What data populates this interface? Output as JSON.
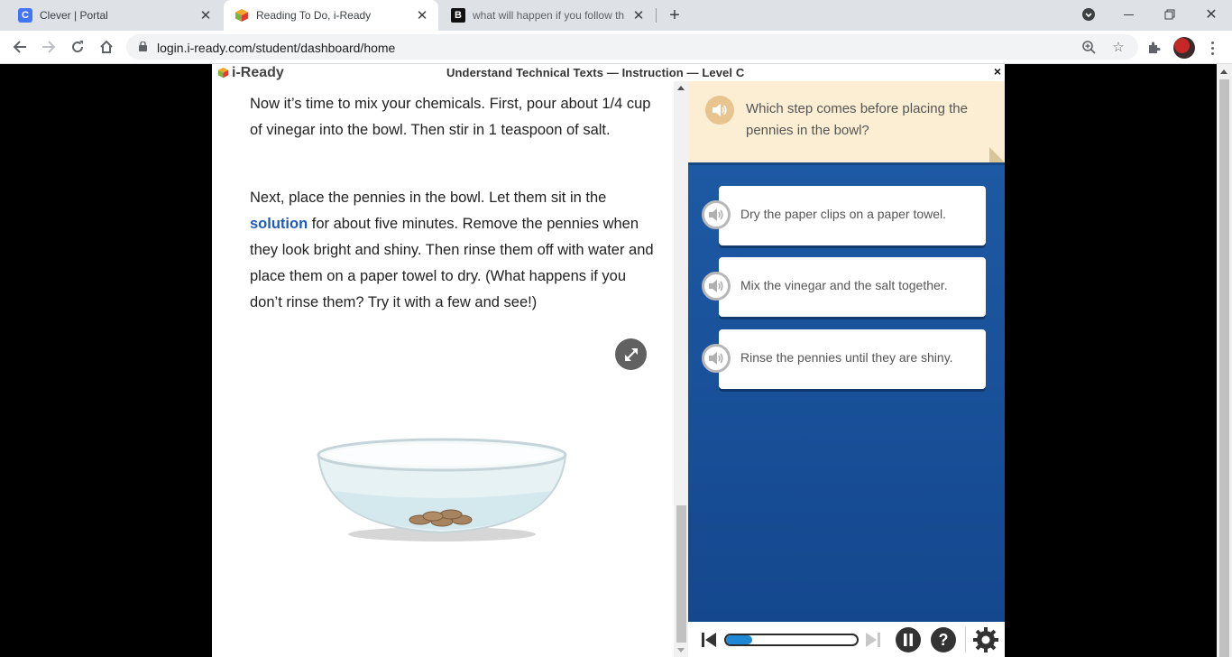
{
  "browser": {
    "tabs": [
      {
        "title": "Clever | Portal",
        "favicon": "clever-icon",
        "favicon_letter": "C",
        "active": false
      },
      {
        "title": "Reading To Do, i-Ready",
        "favicon": "iready-cube-icon",
        "active": true
      },
      {
        "title": "what will happen if you follow th",
        "favicon": "brainly-icon",
        "favicon_letter": "B",
        "active": false
      }
    ],
    "url": "login.i-ready.com/student/dashboard/home"
  },
  "app": {
    "logo_text": "i-Ready",
    "lesson_title": "Understand Technical Texts — Instruction — Level C",
    "close_glyph": "×"
  },
  "reading": {
    "paragraph1": "Now it’s time to mix your chemicals. First, pour about 1/4 cup of vinegar into the bowl. Then stir in 1 teaspoon of salt.",
    "paragraph2_before": "Next, place the pennies in the bowl. Let them sit in the ",
    "paragraph2_keyword": "solution",
    "paragraph2_after": " for about five minutes. Remove the pennies when they look bright and shiny. Then rinse them off with water and place them on a paper towel to dry. (What happens if you don’t rinse them? Try it with a few and see!)"
  },
  "question": {
    "prompt": "Which step comes before placing the pennies in the bowl?",
    "answers": [
      "Dry the paper clips on a paper towel.",
      "Mix the vinegar and the salt together.",
      "Rinse the pennies until they are shiny."
    ]
  },
  "player": {
    "progress_fraction": 0.2
  },
  "colors": {
    "accent_blue": "#1f5da8",
    "keyword_blue": "#1e5bb8",
    "note_yellow": "#fbeed3"
  }
}
